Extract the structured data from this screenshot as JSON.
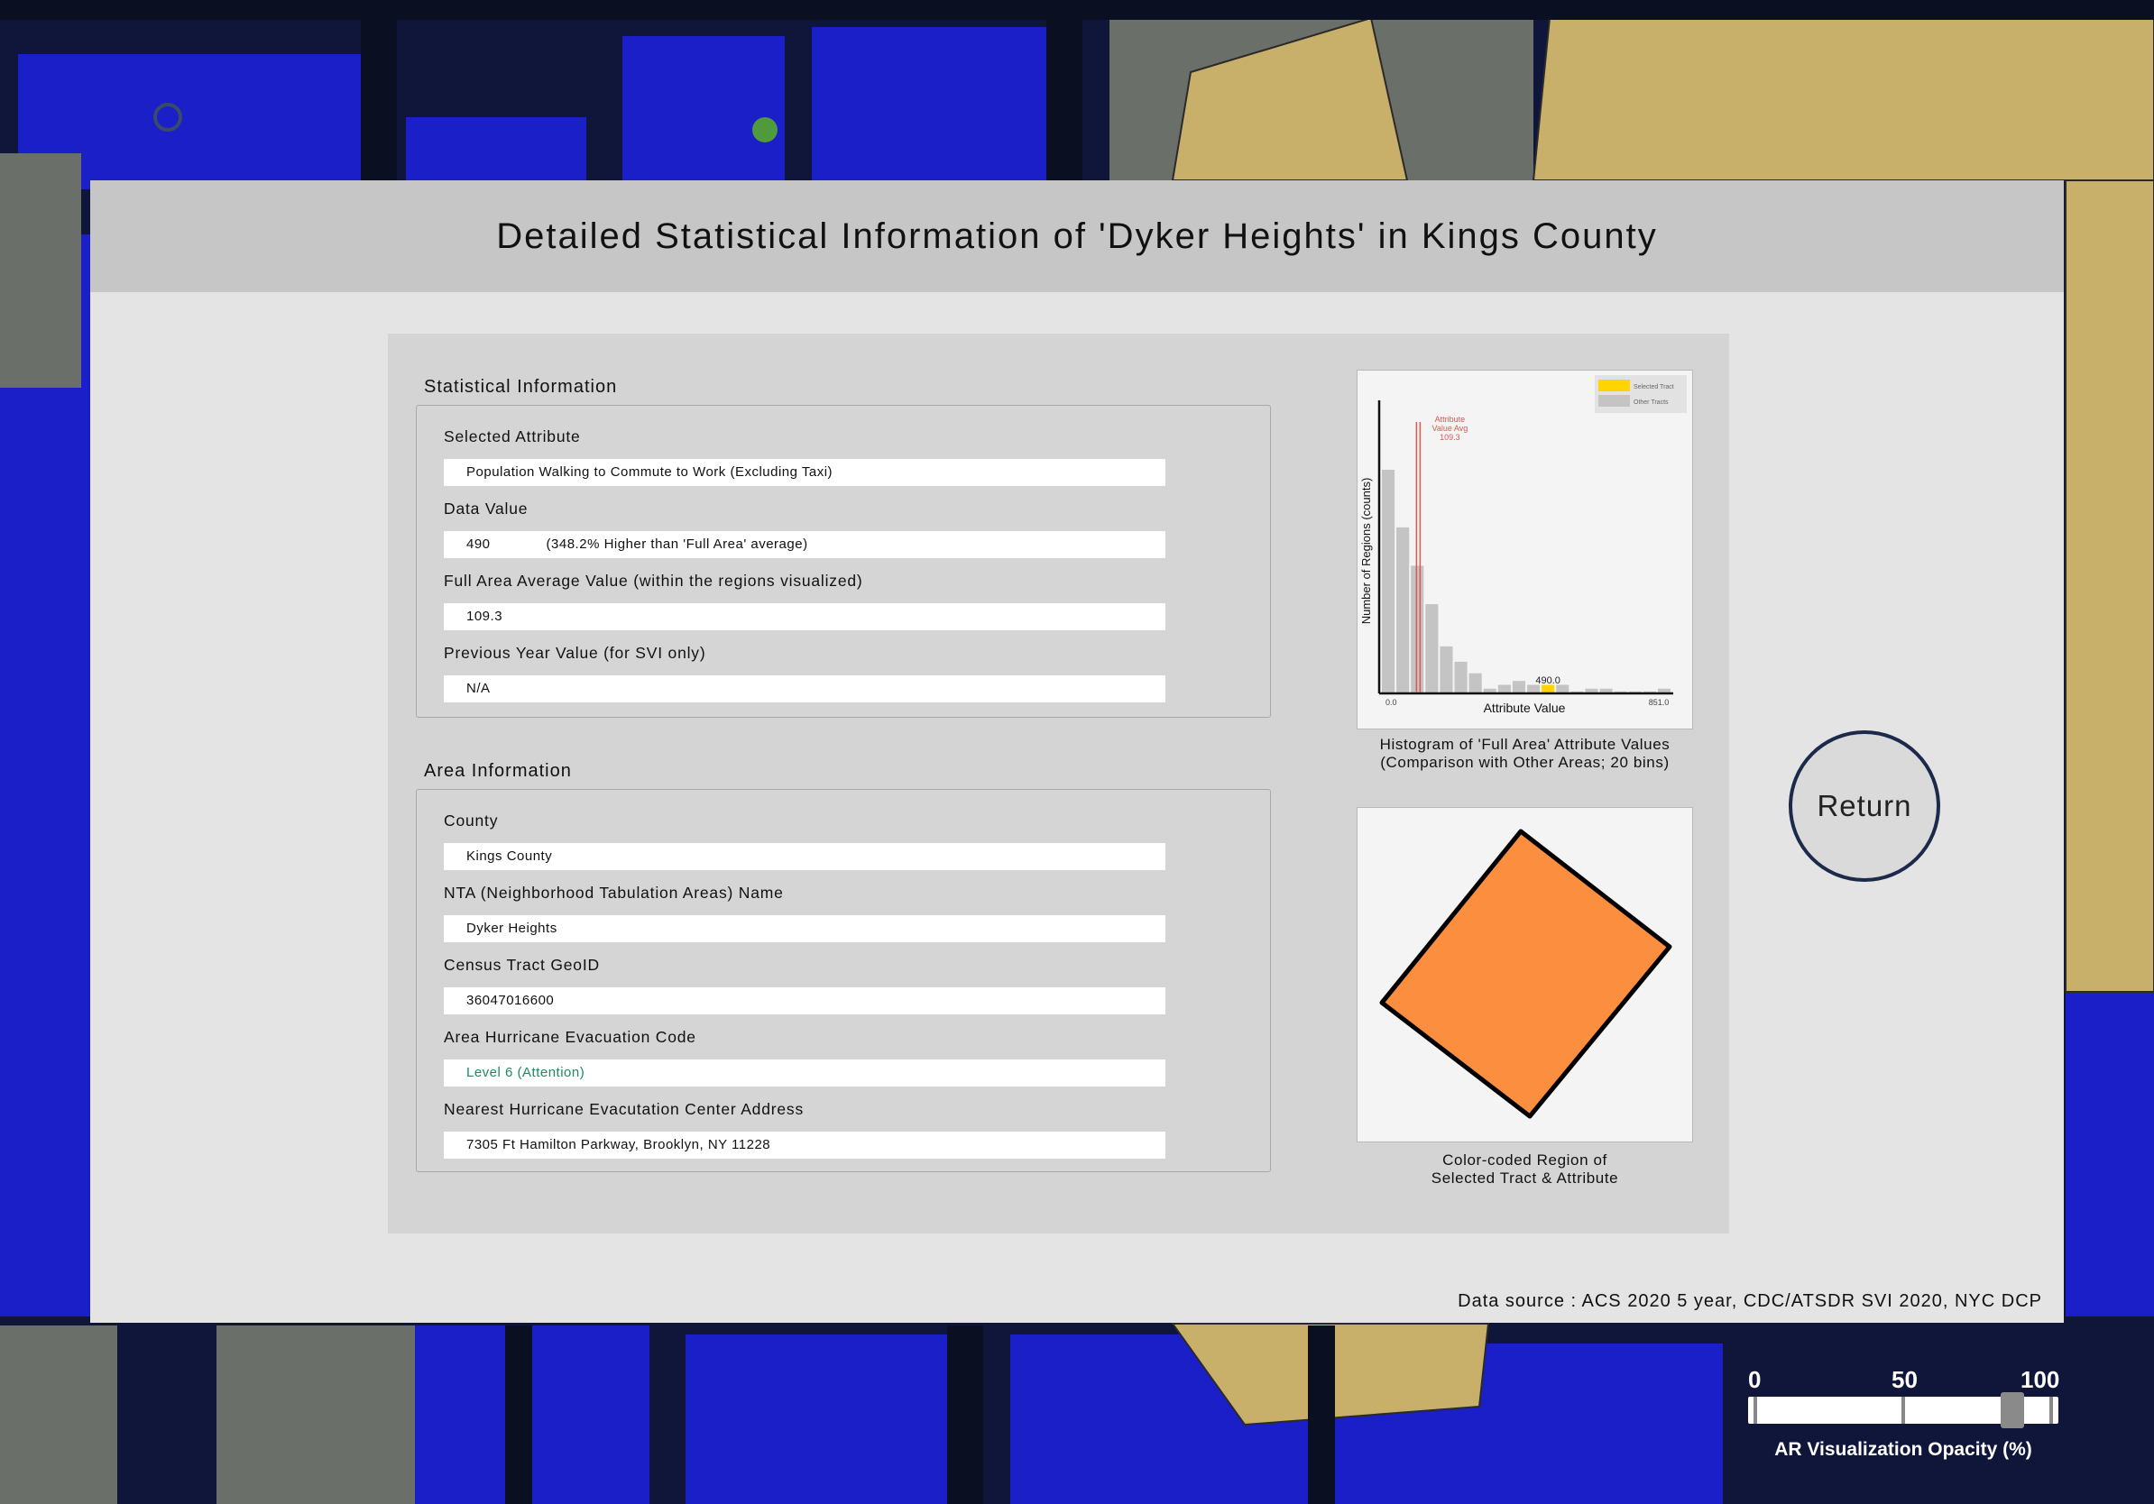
{
  "panel": {
    "title": "Detailed Statistical Information of 'Dyker Heights' in Kings County",
    "data_source": "Data source : ACS 2020 5 year, CDC/ATSDR SVI 2020, NYC DCP"
  },
  "statistical_info": {
    "title": "Statistical Information",
    "selected_attribute_label": "Selected Attribute",
    "selected_attribute_value": "Population Walking to Commute to Work (Excluding Taxi)",
    "data_value_label": "Data Value",
    "data_value": "490",
    "data_value_comparison": "(348.2% Higher than 'Full Area' average)",
    "full_area_avg_label": "Full Area Average Value (within the regions visualized)",
    "full_area_avg_value": "109.3",
    "prev_year_label": "Previous Year Value (for SVI only)",
    "prev_year_value": "N/A"
  },
  "area_info": {
    "title": "Area Information",
    "county_label": "County",
    "county_value": "Kings County",
    "nta_label": "NTA (Neighborhood Tabulation Areas) Name",
    "nta_value": "Dyker Heights",
    "geoid_label": "Census Tract GeoID",
    "geoid_value": "36047016600",
    "evac_code_label": "Area Hurricane Evacuation Code",
    "evac_code_value": "Level 6 (Attention)",
    "evac_center_label": "Nearest Hurricane Evacutation Center Address",
    "evac_center_value": "7305 Ft Hamilton Parkway, Brooklyn, NY 11228"
  },
  "histogram_caption": "Histogram of 'Full Area' Attribute Values\n(Comparison with Other Areas; 20 bins)",
  "region_caption": "Color-coded Region of\nSelected Tract & Attribute",
  "region_color": "#fb8f3f",
  "return_button": "Return",
  "opacity": {
    "label": "AR Visualization Opacity (%)",
    "ticks": [
      "0",
      "50",
      "100"
    ],
    "value": 87
  },
  "colors": {
    "selected_tract": "#ffd400",
    "other_tracts": "#c4c4c4",
    "avg_line": "#e05555",
    "evac_green": "#1e8a5f"
  },
  "chart_data": {
    "type": "bar",
    "title": "",
    "xlabel": "Attribute Value",
    "ylabel": "Number of Regions (counts)",
    "x_tick_labels": [
      "0.0",
      "851.0"
    ],
    "xlim": [
      0,
      851
    ],
    "bins": 20,
    "values": [
      58,
      43,
      33,
      23,
      12,
      8,
      5,
      1,
      2,
      3,
      2,
      2,
      2,
      0,
      1,
      1,
      0,
      0,
      0,
      1
    ],
    "selected_bin": 11,
    "selected_value": 490,
    "selected_value_label": "490.0",
    "average_value": 109.3,
    "average_label": [
      "Attribute",
      "Value Avg",
      "109.3"
    ],
    "legend": [
      "Selected Tract",
      "Other Tracts"
    ],
    "legend_position": "top-right"
  }
}
